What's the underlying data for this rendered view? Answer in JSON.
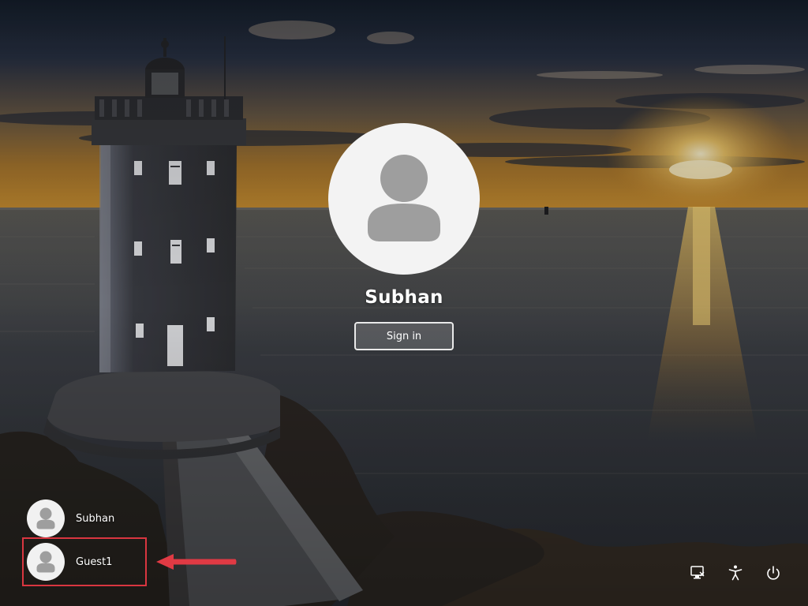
{
  "signin": {
    "user_name": "Subhan",
    "button_label": "Sign in"
  },
  "user_list": {
    "items": [
      {
        "label": "Subhan"
      },
      {
        "label": "Guest1"
      }
    ]
  },
  "corner_icons": {
    "network": "network-icon",
    "accessibility": "accessibility-icon",
    "power": "power-icon"
  },
  "colors": {
    "highlight_box": "#d93640",
    "avatar_bg": "#f3f3f3",
    "avatar_glyph": "#9e9e9e"
  }
}
